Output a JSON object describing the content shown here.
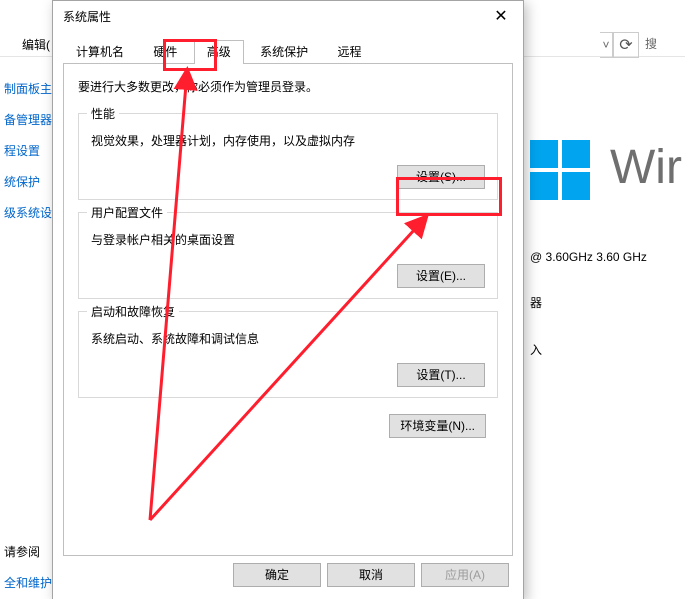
{
  "background": {
    "edit_menu": "编辑(",
    "refresh_icon": "⟳",
    "search_placeholder": "搜",
    "select_caret": "˅",
    "left_links": [
      "制面板主页",
      "备管理器",
      "程设置",
      "统保护",
      "级系统设置"
    ],
    "win_text": "Wir",
    "specs_line1": "@ 3.60GHz   3.60 GHz",
    "specs_line2": "器",
    "specs_line3": "入",
    "bottom_label": "请参阅",
    "bottom_link": "全和维护"
  },
  "dialog": {
    "title": "系统属性",
    "close": "✕",
    "tabs": {
      "computer_name": "计算机名",
      "hardware": "硬件",
      "advanced": "高级",
      "system_protection": "系统保护",
      "remote": "远程",
      "active_index": 2
    },
    "note": "要进行大多数更改，你必须作为管理员登录。",
    "perf": {
      "title": "性能",
      "desc": "视觉效果，处理器计划，内存使用，以及虚拟内存",
      "btn": "设置(S)..."
    },
    "profiles": {
      "title": "用户配置文件",
      "desc": "与登录帐户相关的桌面设置",
      "btn": "设置(E)..."
    },
    "startup": {
      "title": "启动和故障恢复",
      "desc": "系统启动、系统故障和调试信息",
      "btn": "设置(T)..."
    },
    "env_btn": "环境变量(N)...",
    "ok": "确定",
    "cancel": "取消",
    "apply": "应用(A)"
  }
}
